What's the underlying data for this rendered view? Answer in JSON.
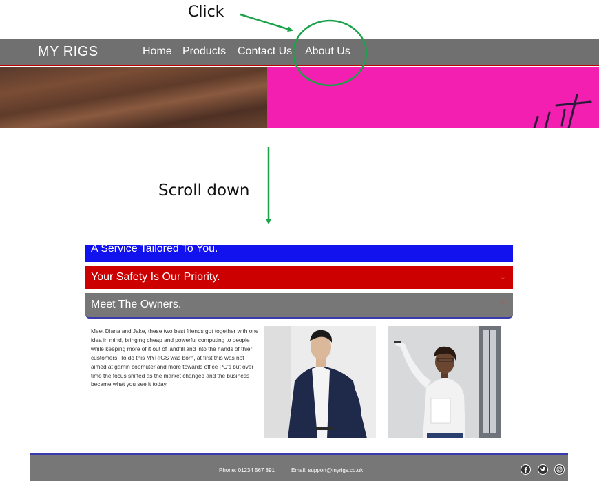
{
  "annotations": {
    "click_label": "Click",
    "scroll_label": "Scroll down"
  },
  "colors": {
    "annotation_green": "#1aa34a",
    "nav_bg": "#707070",
    "nav_border": "#c00000",
    "accordion_blue": "#1212ee",
    "accordion_red": "#cc0000",
    "accordion_grey": "#777777",
    "hero_pink": "#f21fb0"
  },
  "navbar": {
    "brand": "MY RIGS",
    "links": [
      "Home",
      "Products",
      "Contact Us",
      "About Us"
    ]
  },
  "accordion": {
    "items": [
      {
        "title": "A Service Tailored To You.",
        "state": "collapsed"
      },
      {
        "title": "Your Safety Is Our Priority.",
        "state": "collapsed"
      },
      {
        "title": "Meet The Owners.",
        "state": "expanded"
      }
    ]
  },
  "owners": {
    "text": "Meet Diana and Jake, these two best friends got together with one idea in mind, bringing cheap and powerful computing to people while keeping more of it out of landfill and into the hands of thier customers. To do this MYRIGS was born, at first this was not aimed at gamin copmuter and more towards office PC's but over time the focus shifted as the market changed and the business became what you see it today."
  },
  "footer": {
    "phone": "Phone: 01234 567 891",
    "email": "Email: support@myrigs.co.uk",
    "social_icons": [
      "facebook-icon",
      "twitter-icon",
      "instagram-icon"
    ]
  }
}
